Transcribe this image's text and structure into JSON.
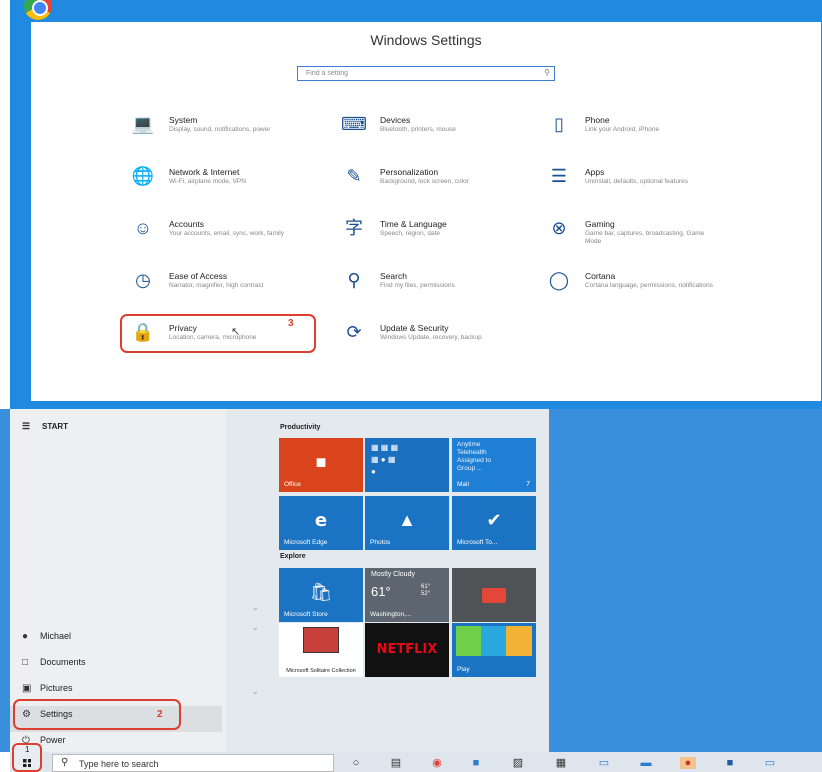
{
  "settings": {
    "title": "Windows Settings",
    "search_placeholder": "Find a setting",
    "categories": [
      {
        "name": "System",
        "desc": "Display, sound, notifications, power",
        "icon": "laptop-icon"
      },
      {
        "name": "Devices",
        "desc": "Bluetooth, printers, mouse",
        "icon": "keyboard-icon"
      },
      {
        "name": "Phone",
        "desc": "Link your Android, iPhone",
        "icon": "phone-icon"
      },
      {
        "name": "Network & Internet",
        "desc": "Wi-Fi, airplane mode, VPN",
        "icon": "globe-icon"
      },
      {
        "name": "Personalization",
        "desc": "Background, lock screen, color",
        "icon": "paint-icon"
      },
      {
        "name": "Apps",
        "desc": "Uninstall, defaults, optional features",
        "icon": "apps-list-icon"
      },
      {
        "name": "Accounts",
        "desc": "Your accounts, email, sync, work, family",
        "icon": "person-icon"
      },
      {
        "name": "Time & Language",
        "desc": "Speech, region, date",
        "icon": "time-language-icon"
      },
      {
        "name": "Gaming",
        "desc": "Game bar, captures, broadcasting, Game Mode",
        "icon": "xbox-icon"
      },
      {
        "name": "Ease of Access",
        "desc": "Narrator, magnifier, high contrast",
        "icon": "ease-of-access-icon"
      },
      {
        "name": "Search",
        "desc": "Find my files, permissions",
        "icon": "search-icon"
      },
      {
        "name": "Cortana",
        "desc": "Cortana language, permissions, notifications",
        "icon": "cortana-icon"
      },
      {
        "name": "Privacy",
        "desc": "Location, camera, microphone",
        "icon": "lock-icon"
      },
      {
        "name": "Update & Security",
        "desc": "Windows Update, recovery, backup",
        "icon": "update-icon"
      }
    ],
    "step3": "3"
  },
  "start_menu": {
    "header": "START",
    "user": "Michael",
    "documents": "Documents",
    "pictures": "Pictures",
    "settings": "Settings",
    "power": "Power",
    "step2": "2",
    "groups": {
      "productivity": "Productivity",
      "explore": "Explore"
    },
    "tiles": {
      "office": "Office",
      "mail": "Mail",
      "mail_line1": "Anytime",
      "mail_line2": "Telehealth",
      "mail_line3": "Assigned to",
      "mail_line4": "Group ...",
      "mail_count": "7",
      "edge": "Microsoft Edge",
      "photos": "Photos",
      "todo": "Microsoft To...",
      "store": "Microsoft Store",
      "weather_cond": "Mostly Cloudy",
      "weather_temp": "61°",
      "weather_hi": "61°",
      "weather_lo": "52°",
      "weather_city": "Washington,...",
      "solitaire": "Microsoft Solitaire Collection",
      "netflix": "NETFLIX",
      "play": "Play"
    }
  },
  "taskbar": {
    "search_placeholder": "Type here to search",
    "step1": "1"
  }
}
